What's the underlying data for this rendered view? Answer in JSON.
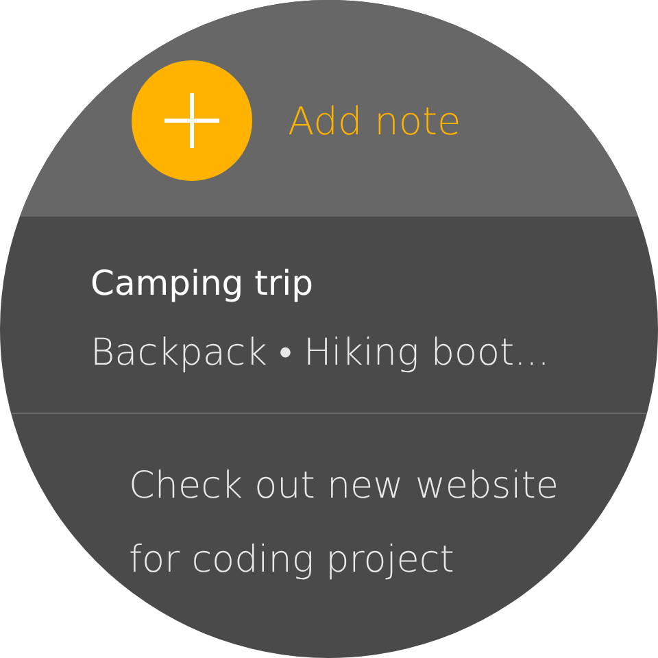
{
  "add_button": {
    "label": "Add note"
  },
  "notes": [
    {
      "title": "Camping trip",
      "body": "Backpack • Hiking boot..."
    },
    {
      "body": "Check out new website for coding project"
    }
  ]
}
